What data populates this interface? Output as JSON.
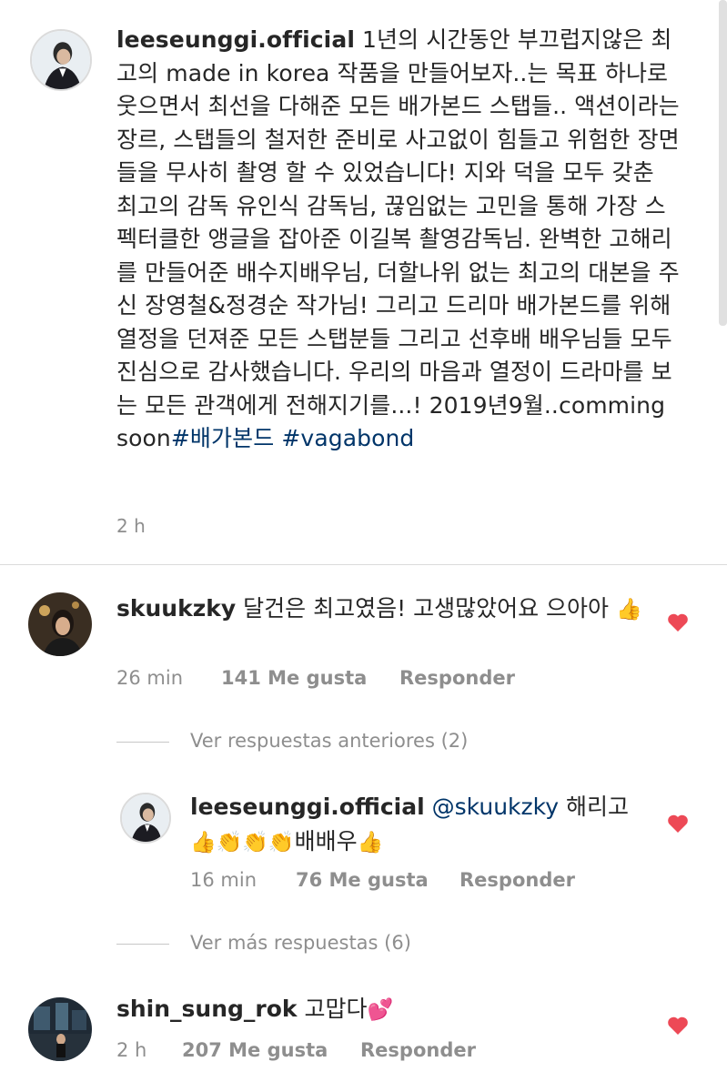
{
  "caption": {
    "username": "leeseunggi.official",
    "text": "1년의 시간동안 부끄럽지않은 최고의 made in korea 작품을 만들어보자..는 목표 하나로 웃으면서 최선을 다해준 모든 배가본드 스탭들.. 액션이라는 장르, 스탭들의 철저한 준비로 사고없이 힘들고 위험한 장면들을 무사히 촬영 할 수 있었습니다! 지와 덕을 모두 갖춘 최고의 감독 유인식 감독님, 끊임없는 고민을 통해 가장 스펙터클한 앵글을 잡아준 이길복 촬영감독님. 완벽한 고해리를 만들어준 배수지배우님, 더할나위 없는 최고의 대본을 주신 장영철&정경순 작가님!  그리고 드리마 배가본드를 위해 열정을 던져준 모든 스탭분들 그리고 선후배 배우님들 모두 진심으로 감사했습니다. 우리의 마음과 열정이 드라마를 보는 모든 관객에게 전해지기를...! 2019년9월..comming soon",
    "hashtag1": "#배가본드",
    "hashtag2": "#vagabond",
    "time": "2 h"
  },
  "comments": [
    {
      "username": "skuukzky",
      "text": "달건은 최고였음! 고생많았어요 으아아",
      "emoji": "👍",
      "time": "26 min",
      "likes": "141 Me gusta",
      "reply": "Responder"
    }
  ],
  "view_previous": "Ver respuestas anteriores (2)",
  "reply": {
    "username": "leeseunggi.official",
    "mention": "@skuukzky",
    "text1": "해리고",
    "emojis": "👍👏👏👏",
    "text2": "배배우",
    "emoji_end": "👍",
    "time": "16 min",
    "likes": "76 Me gusta",
    "reply_label": "Responder"
  },
  "view_more": "Ver más respuestas (6)",
  "comment3": {
    "username": "shin_sung_rok",
    "text": "고맙다",
    "emoji": "💕",
    "time": "2 h",
    "likes": "207 Me gusta",
    "reply_label": "Responder"
  },
  "colors": {
    "heart": "#ed4956",
    "hashtag": "#003569",
    "meta": "#8e8e8e"
  },
  "icons": [
    "avatar",
    "heart-icon",
    "thumbs-up-emoji",
    "clapping-emoji",
    "hearts-emoji"
  ]
}
